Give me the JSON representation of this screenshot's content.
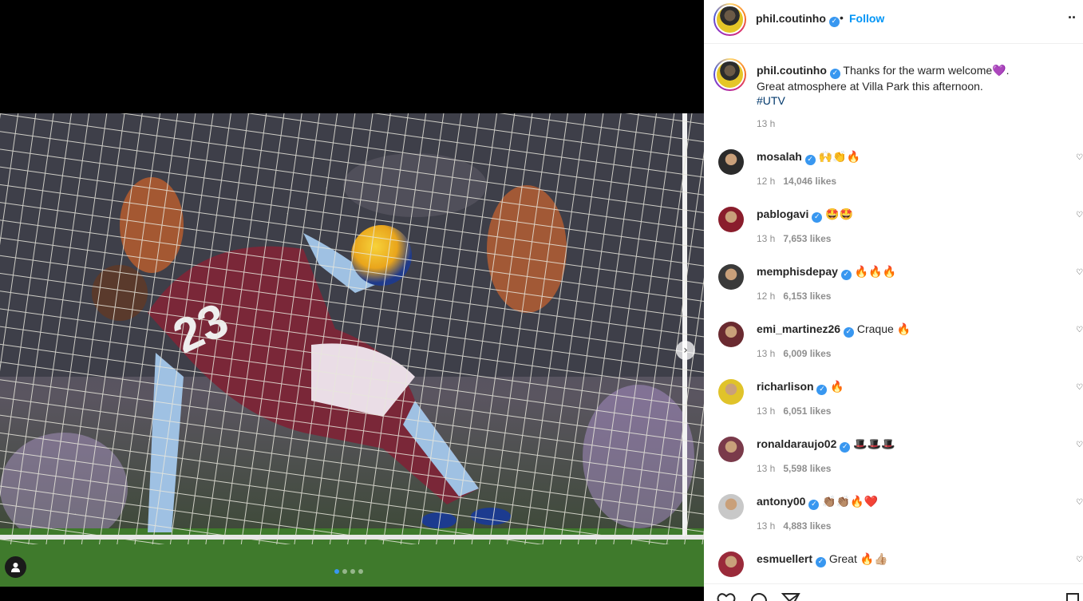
{
  "post": {
    "carousel": {
      "slide_count": 4,
      "active_index": 0
    },
    "author": {
      "username": "phil.coutinho",
      "verified": true
    },
    "header": {
      "follow_label": "Follow",
      "separator": "•",
      "more_label": "··"
    },
    "caption": {
      "username": "phil.coutinho",
      "text": "Thanks for the warm welcome💜.",
      "line2": "Great atmosphere at Villa Park this afternoon.",
      "hashtag": "#UTV",
      "time": "13 h"
    }
  },
  "comments": [
    {
      "username": "mosalah",
      "text": "🙌👏🔥",
      "time": "12 h",
      "likes": "14,046 likes",
      "avatar_color": "#2b2b2b"
    },
    {
      "username": "pablogavi",
      "text": "🤩🤩",
      "time": "13 h",
      "likes": "7,653 likes",
      "avatar_color": "#8a1d2c"
    },
    {
      "username": "memphisdepay",
      "text": "🔥🔥🔥",
      "time": "12 h",
      "likes": "6,153 likes",
      "avatar_color": "#3a3a3a"
    },
    {
      "username": "emi_martinez26",
      "text": "Craque 🔥",
      "time": "13 h",
      "likes": "6,009 likes",
      "avatar_color": "#6a2a30"
    },
    {
      "username": "richarlison",
      "text": "🔥",
      "time": "13 h",
      "likes": "6,051 likes",
      "avatar_color": "#e0c32a"
    },
    {
      "username": "ronaldaraujo02",
      "text": "🎩🎩🎩",
      "time": "13 h",
      "likes": "5,598 likes",
      "avatar_color": "#7a3a4a"
    },
    {
      "username": "antony00",
      "text": "👏🏽👏🏽🔥❤️",
      "time": "13 h",
      "likes": "4,883 likes",
      "avatar_color": "#c8c8c8"
    },
    {
      "username": "esmuellert",
      "text": "Great 🔥👍🏼",
      "time": "",
      "likes": "",
      "avatar_color": "#9a2a3a"
    }
  ],
  "icons": {
    "verified": "verified-badge-icon",
    "next": "chevron-right-icon",
    "tagged": "user-tag-icon",
    "like": "heart-icon",
    "comment": "comment-bubble-icon",
    "share": "paper-plane-icon",
    "save": "bookmark-icon"
  },
  "colors": {
    "accent": "#0095f6",
    "verified": "#3897f0",
    "muted": "#8e8e8e"
  }
}
